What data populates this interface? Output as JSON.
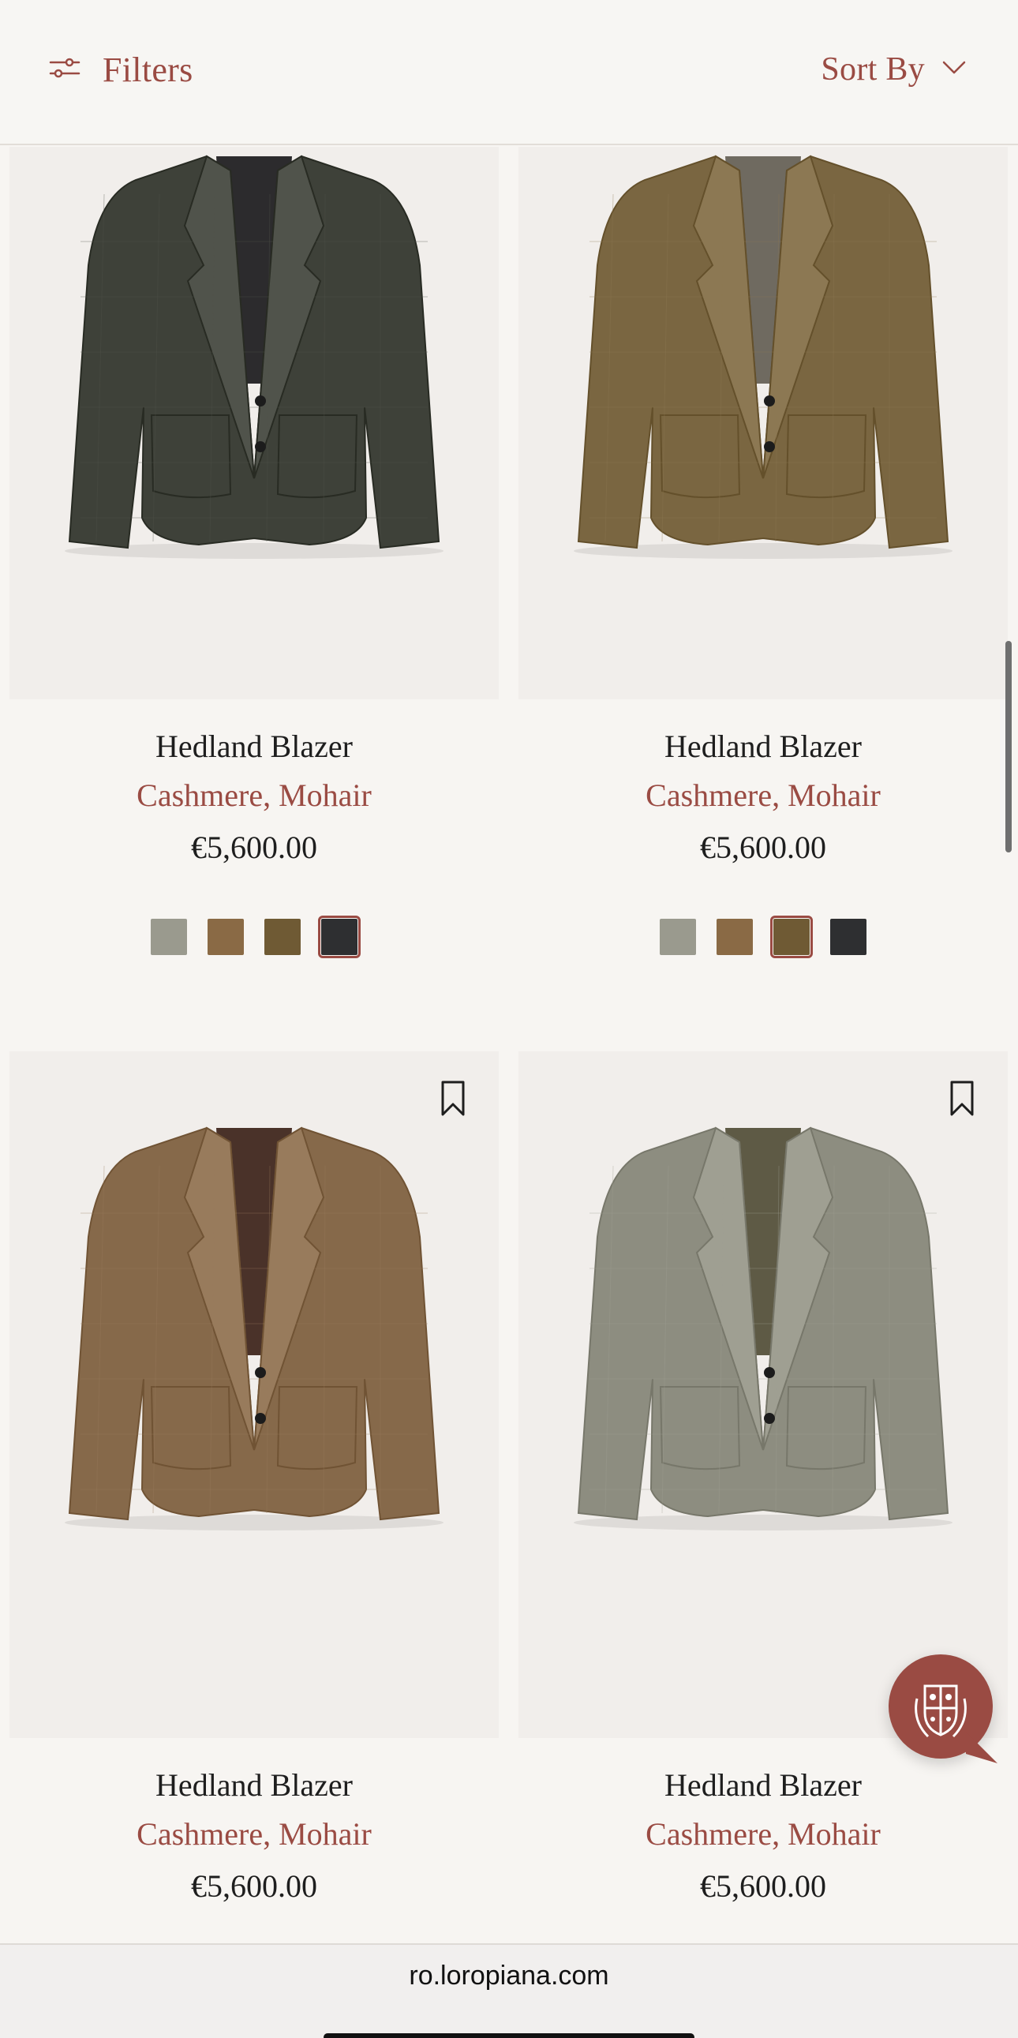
{
  "header": {
    "filters_label": "Filters",
    "filters_icon": "sliders-icon",
    "sort_label": "Sort By",
    "sort_icon": "chevron-down-icon"
  },
  "products": [
    {
      "name": "Hedland Blazer",
      "material": "Cashmere, Mohair",
      "price": "€5,600.00",
      "jacket_color": "#3e4139",
      "lining_color": "#2c2b2d",
      "swatches": [
        {
          "color": "#9a9a8e",
          "selected": false
        },
        {
          "color": "#8a6a45",
          "selected": false
        },
        {
          "color": "#6f5a34",
          "selected": false
        },
        {
          "color": "#2e2f31",
          "selected": true
        }
      ]
    },
    {
      "name": "Hedland Blazer",
      "material": "Cashmere, Mohair",
      "price": "€5,600.00",
      "jacket_color": "#7a6641",
      "lining_color": "#6f6a60",
      "swatches": [
        {
          "color": "#9a9a8e",
          "selected": false
        },
        {
          "color": "#8a6a45",
          "selected": false
        },
        {
          "color": "#6f5a34",
          "selected": true
        },
        {
          "color": "#2e2f31",
          "selected": false
        }
      ]
    },
    {
      "name": "Hedland Blazer",
      "material": "Cashmere, Mohair",
      "price": "€5,600.00",
      "jacket_color": "#86694a",
      "lining_color": "#4a3229",
      "bookmark_icon": "bookmark-icon"
    },
    {
      "name": "Hedland Blazer",
      "material": "Cashmere, Mohair",
      "price": "€5,600.00",
      "jacket_color": "#8d8d80",
      "lining_color": "#5e5a45",
      "bookmark_icon": "bookmark-icon"
    }
  ],
  "chat_button_icon": "crest-icon",
  "browser": {
    "url": "ro.loropiana.com"
  },
  "colors": {
    "accent": "#9a4b43",
    "background": "#f7f5f2",
    "image_bg": "#f1eeeb"
  }
}
